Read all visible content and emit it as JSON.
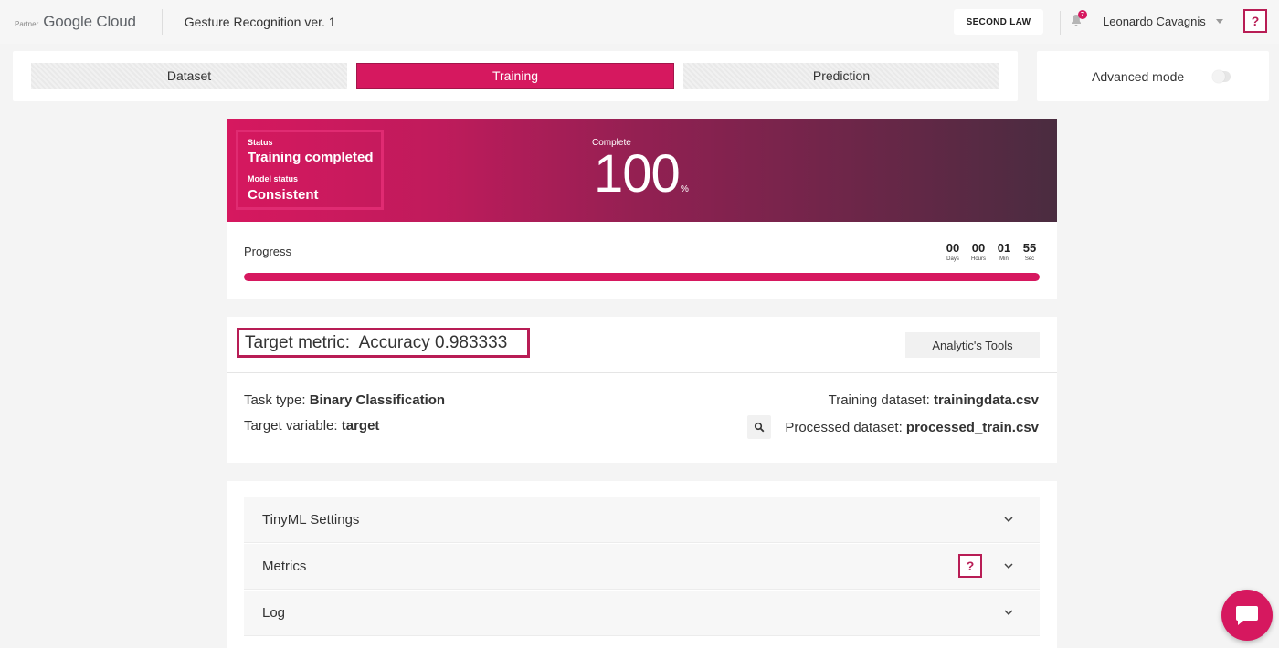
{
  "header": {
    "partner_label": "Partner",
    "brand_name": "Google Cloud",
    "project_title": "Gesture Recognition ver. 1",
    "org_button": "SECOND LAW",
    "notification_count": "7",
    "user_name": "Leonardo Cavagnis",
    "help_label": "?"
  },
  "tabs": [
    {
      "label": "Dataset",
      "active": false
    },
    {
      "label": "Training",
      "active": true
    },
    {
      "label": "Prediction",
      "active": false
    }
  ],
  "advanced_mode": {
    "label": "Advanced mode",
    "enabled": false
  },
  "status": {
    "status_label": "Status",
    "status_value": "Training completed",
    "model_status_label": "Model status",
    "model_status_value": "Consistent",
    "complete_label": "Complete",
    "complete_value": "100",
    "complete_unit": "%"
  },
  "progress": {
    "label": "Progress",
    "percent": 100,
    "countdown": [
      {
        "value": "00",
        "unit": "Days"
      },
      {
        "value": "00",
        "unit": "Hours"
      },
      {
        "value": "01",
        "unit": "Min"
      },
      {
        "value": "55",
        "unit": "Sec"
      }
    ]
  },
  "metric": {
    "target_text": "Target metric:  Accuracy 0.983333",
    "analytics_button": "Analytic's Tools",
    "task_type_label": "Task type:",
    "task_type_value": "Binary Classification",
    "target_variable_label": "Target variable:",
    "target_variable_value": "target",
    "training_dataset_label": "Training dataset:",
    "training_dataset_value": "trainingdata.csv",
    "processed_dataset_label": "Processed dataset:",
    "processed_dataset_value": "processed_train.csv"
  },
  "accordion": [
    {
      "title": "TinyML Settings"
    },
    {
      "title": "Metrics",
      "help": "?"
    },
    {
      "title": "Log"
    }
  ],
  "colors": {
    "accent": "#d6185f",
    "accent_dark": "#b81d55",
    "banner_end": "#4a2c40"
  },
  "icons": {
    "notifications": "bell-icon",
    "user_menu": "chevron-down-icon",
    "processed_dataset": "search-icon",
    "accordion": "chevron-down-icon",
    "chat": "chat-bubble-icon"
  }
}
